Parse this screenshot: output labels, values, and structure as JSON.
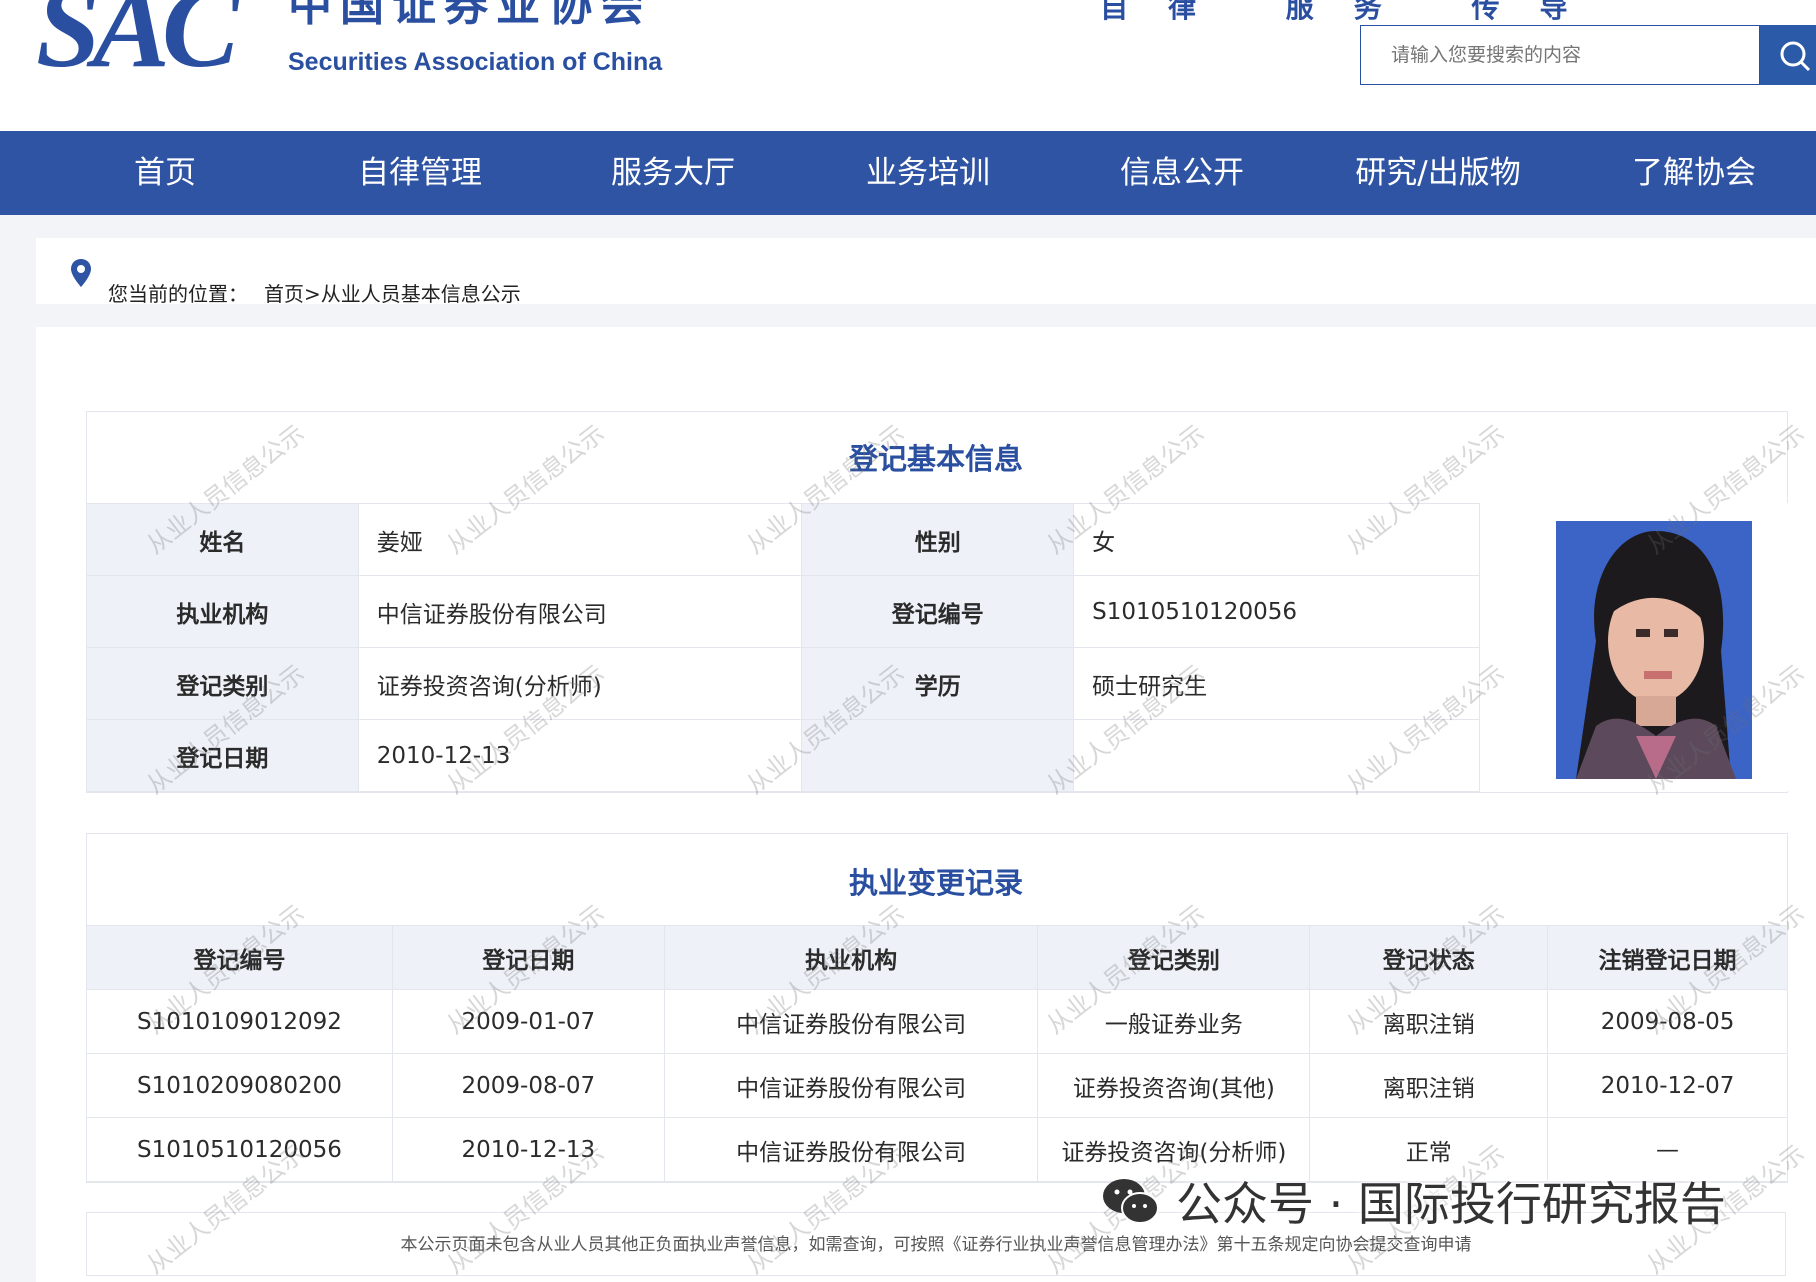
{
  "header": {
    "logo_mark": "SAC",
    "logo_cn": "中国证券业协会",
    "logo_en": "Securities Association of China",
    "top_links": "自律 服务 传导",
    "search_placeholder": "请输入您要搜索的内容",
    "accent_color": "#2f54a3"
  },
  "nav": {
    "items": [
      {
        "label": "首页"
      },
      {
        "label": "自律管理"
      },
      {
        "label": "服务大厅"
      },
      {
        "label": "业务培训"
      },
      {
        "label": "信息公开"
      },
      {
        "label": "研究/出版物"
      },
      {
        "label": "了解协会"
      }
    ]
  },
  "breadcrumb": {
    "label": "您当前的位置：",
    "path": "首页>从业人员基本信息公示"
  },
  "basic_info": {
    "title": "登记基本信息",
    "name_label": "姓名",
    "name": "姜娅",
    "gender_label": "性别",
    "gender": "女",
    "org_label": "执业机构",
    "org": "中信证券股份有限公司",
    "reg_no_label": "登记编号",
    "reg_no": "S1010510120056",
    "category_label": "登记类别",
    "category": "证券投资咨询(分析师)",
    "edu_label": "学历",
    "edu": "硕士研究生",
    "date_label": "登记日期",
    "date": "2010-12-13"
  },
  "records": {
    "title": "执业变更记录",
    "headers": [
      "登记编号",
      "登记日期",
      "执业机构",
      "登记类别",
      "登记状态",
      "注销登记日期"
    ],
    "rows": [
      [
        "S1010109012092",
        "2009-01-07",
        "中信证券股份有限公司",
        "一般证券业务",
        "离职注销",
        "2009-08-05"
      ],
      [
        "S1010209080200",
        "2009-08-07",
        "中信证券股份有限公司",
        "证券投资咨询(其他)",
        "离职注销",
        "2010-12-07"
      ],
      [
        "S1010510120056",
        "2010-12-13",
        "中信证券股份有限公司",
        "证券投资咨询(分析师)",
        "正常",
        "—"
      ]
    ]
  },
  "notice": "本公示页面未包含从业人员其他正负面执业声誉信息，如需查询，可按照《证券行业执业声誉信息管理办法》第十五条规定向协会提交查询申请",
  "watermark": "从业人员信息公示",
  "wechat_overlay": "公众号 · 国际投行研究报告"
}
